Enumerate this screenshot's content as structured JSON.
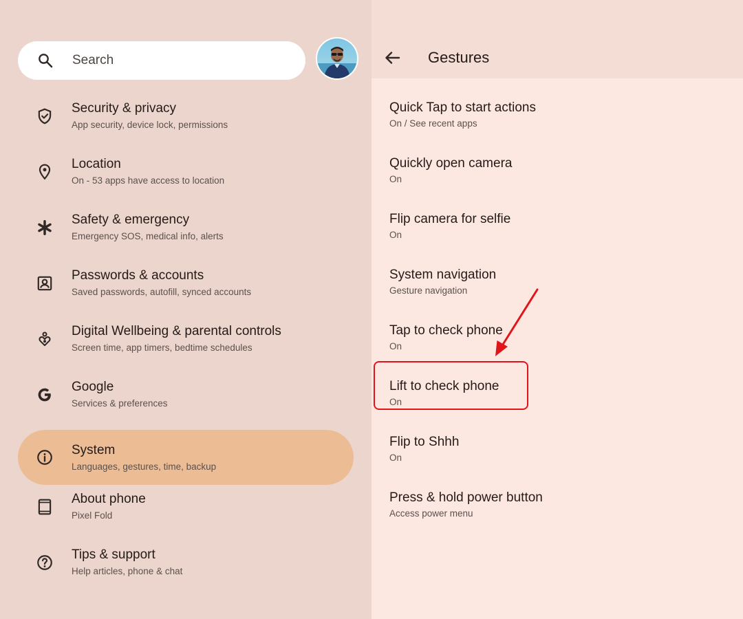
{
  "search": {
    "label": "Search",
    "icon": "search-icon"
  },
  "profile": {
    "avatar": "avatar"
  },
  "sidebar": {
    "items": [
      {
        "title": "Security & privacy",
        "subtitle": "App security, device lock, permissions",
        "icon": "shield-check-icon"
      },
      {
        "title": "Location",
        "subtitle": "On - 53 apps have access to location",
        "icon": "location-pin-icon"
      },
      {
        "title": "Safety & emergency",
        "subtitle": "Emergency SOS, medical info, alerts",
        "icon": "asterisk-icon"
      },
      {
        "title": "Passwords & accounts",
        "subtitle": "Saved passwords, autofill, synced accounts",
        "icon": "account-box-icon"
      },
      {
        "title": "Digital Wellbeing & parental controls",
        "subtitle": "Screen time, app timers, bedtime schedules",
        "icon": "wellbeing-icon"
      },
      {
        "title": "Google",
        "subtitle": "Services & preferences",
        "icon": "google-g-icon"
      },
      {
        "title": "System",
        "subtitle": "Languages, gestures, time, backup",
        "icon": "info-icon",
        "selected": true
      },
      {
        "title": "About phone",
        "subtitle": "Pixel Fold",
        "icon": "tablet-icon"
      },
      {
        "title": "Tips & support",
        "subtitle": "Help articles, phone & chat",
        "icon": "help-icon"
      }
    ]
  },
  "detail": {
    "title": "Gestures",
    "back_icon": "back-arrow-icon",
    "items": [
      {
        "title": "Quick Tap to start actions",
        "subtitle": "On / See recent apps"
      },
      {
        "title": "Quickly open camera",
        "subtitle": "On"
      },
      {
        "title": "Flip camera for selfie",
        "subtitle": "On"
      },
      {
        "title": "System navigation",
        "subtitle": "Gesture navigation"
      },
      {
        "title": "Tap to check phone",
        "subtitle": "On"
      },
      {
        "title": "Lift to check phone",
        "subtitle": "On",
        "highlighted": true
      },
      {
        "title": "Flip to Shhh",
        "subtitle": "On"
      },
      {
        "title": "Press & hold power button",
        "subtitle": "Access power menu"
      }
    ]
  },
  "colors": {
    "left_background": "#ecd5cc",
    "right_background": "#fce8e1",
    "selected_item": "#ecbd95",
    "annotation_red": "#e1141b"
  }
}
